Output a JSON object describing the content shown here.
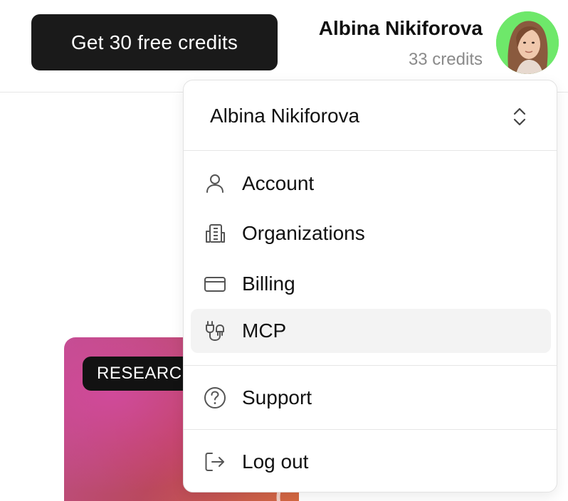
{
  "header": {
    "cta_label": "Get 30 free credits",
    "user_name": "Albina Nikiforova",
    "credits": "33 credits",
    "avatar_bg": "#6ee86a"
  },
  "card": {
    "badge": "RESEARC"
  },
  "menu": {
    "account_name": "Albina Nikiforova",
    "items": [
      {
        "label": "Account",
        "icon": "user-icon"
      },
      {
        "label": "Organizations",
        "icon": "building-icon"
      },
      {
        "label": "Billing",
        "icon": "credit-card-icon"
      },
      {
        "label": "MCP",
        "icon": "plug-icon",
        "active": true
      }
    ],
    "support": {
      "label": "Support",
      "icon": "help-circle-icon"
    },
    "logout": {
      "label": "Log out",
      "icon": "log-out-icon"
    }
  }
}
